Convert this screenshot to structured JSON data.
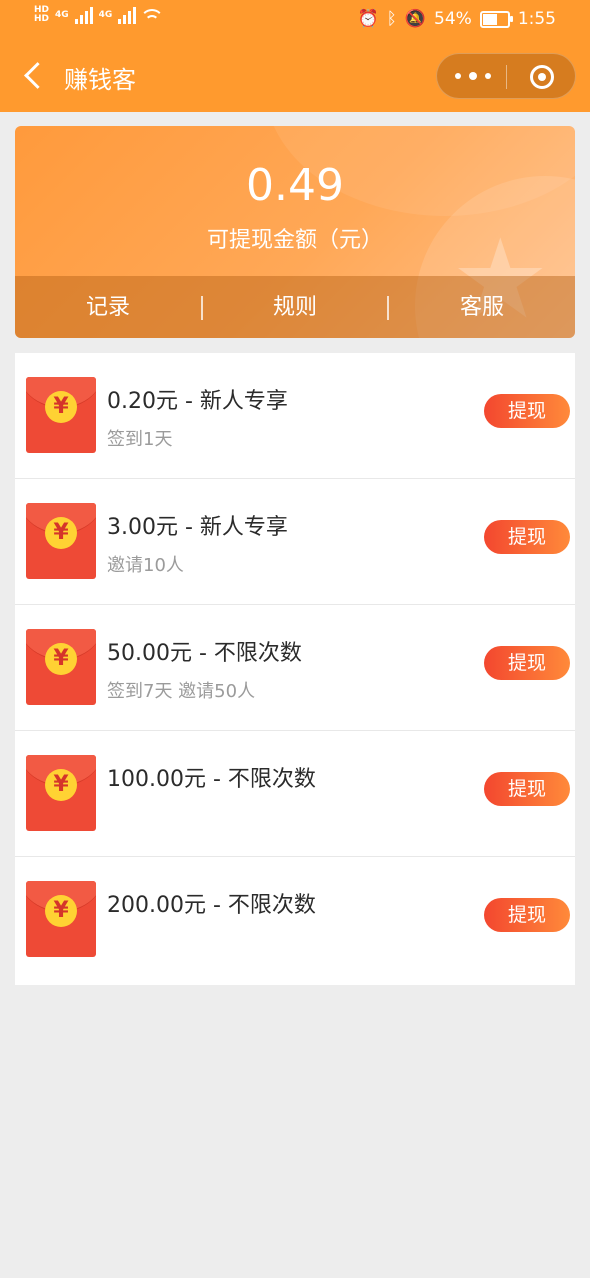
{
  "status_bar": {
    "hd1": "HD",
    "hd2": "HD",
    "net1": "4G",
    "net2": "4G",
    "battery_percent": "54%",
    "battery_level": 0.54,
    "time": "1:55",
    "icons": [
      "alarm-icon",
      "bluetooth-icon",
      "mute-icon",
      "wifi-icon",
      "signal-icon",
      "battery-icon"
    ]
  },
  "nav": {
    "title": "赚钱客",
    "icons": [
      "back-icon",
      "more-icon",
      "close-target-icon"
    ]
  },
  "balance": {
    "amount": "0.49",
    "label": "可提现金额（元）",
    "tabs": [
      "记录",
      "规则",
      "客服"
    ]
  },
  "rewards": [
    {
      "title": "0.20元 - 新人专享",
      "subtitle": "签到1天",
      "button": "提现"
    },
    {
      "title": "3.00元 - 新人专享",
      "subtitle": "邀请10人",
      "button": "提现"
    },
    {
      "title": "50.00元 - 不限次数",
      "subtitle": "签到7天 邀请50人",
      "button": "提现"
    },
    {
      "title": "100.00元 - 不限次数",
      "subtitle": "",
      "button": "提现"
    },
    {
      "title": "200.00元 - 不限次数",
      "subtitle": "",
      "button": "提现"
    }
  ],
  "envelope_symbol": "¥",
  "colors": {
    "header": "#ff9a2e",
    "button_start": "#f3472f",
    "button_end": "#ff8a3a",
    "envelope": "#ee4a36",
    "coin": "#ffd233",
    "background": "#ededed"
  }
}
